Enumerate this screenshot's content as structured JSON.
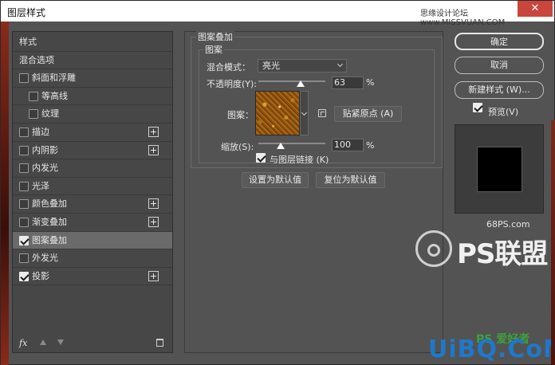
{
  "window": {
    "title": "图层样式",
    "watermark_top": "思缘设计论坛 www.MISSVUAN.COM",
    "close_glyph": "✕"
  },
  "left_panel": {
    "items": [
      {
        "label": "样式",
        "checkbox": false,
        "checked": false,
        "plus": false,
        "indent": 0
      },
      {
        "label": "混合选项",
        "checkbox": false,
        "checked": false,
        "plus": false,
        "indent": 0
      },
      {
        "label": "斜面和浮雕",
        "checkbox": true,
        "checked": false,
        "plus": false,
        "indent": 0
      },
      {
        "label": "等高线",
        "checkbox": true,
        "checked": false,
        "plus": false,
        "indent": 1
      },
      {
        "label": "纹理",
        "checkbox": true,
        "checked": false,
        "plus": false,
        "indent": 1
      },
      {
        "label": "描边",
        "checkbox": true,
        "checked": false,
        "plus": true,
        "indent": 0
      },
      {
        "label": "内阴影",
        "checkbox": true,
        "checked": false,
        "plus": true,
        "indent": 0
      },
      {
        "label": "内发光",
        "checkbox": true,
        "checked": false,
        "plus": false,
        "indent": 0
      },
      {
        "label": "光泽",
        "checkbox": true,
        "checked": false,
        "plus": false,
        "indent": 0
      },
      {
        "label": "颜色叠加",
        "checkbox": true,
        "checked": false,
        "plus": true,
        "indent": 0
      },
      {
        "label": "渐变叠加",
        "checkbox": true,
        "checked": false,
        "plus": true,
        "indent": 0
      },
      {
        "label": "图案叠加",
        "checkbox": true,
        "checked": true,
        "plus": false,
        "indent": 0,
        "selected": true
      },
      {
        "label": "外发光",
        "checkbox": true,
        "checked": false,
        "plus": false,
        "indent": 0
      },
      {
        "label": "投影",
        "checkbox": true,
        "checked": true,
        "plus": true,
        "indent": 0
      }
    ],
    "fx_label": "fx"
  },
  "pattern_overlay": {
    "group_title": "图案叠加",
    "sub_title": "图案",
    "blend_mode_label": "混合模式：",
    "blend_mode_value": "亮光",
    "opacity_label": "不透明度(Y):",
    "opacity_value": "63",
    "opacity_fraction": 0.63,
    "pattern_label": "图案：",
    "snap_button": "贴紧原点 (A)",
    "scale_label": "缩放(S):",
    "scale_value": "100",
    "scale_fraction": 0.33,
    "percent": "%",
    "link_label": "与图层链接 (K)",
    "link_checked": true,
    "set_default_button": "设置为默认值",
    "reset_default_button": "复位为默认值"
  },
  "right_panel": {
    "ok_button": "确定",
    "cancel_button": "取消",
    "new_style_button": "新建样式 (W)...",
    "preview_label": "预览(V)",
    "preview_checked": true
  },
  "watermarks": {
    "site_68ps": "68PS.com",
    "logo_text": "PS联盟",
    "uibq": "UiBQ.CoM",
    "ps_stamp": "PS 爱好者"
  }
}
